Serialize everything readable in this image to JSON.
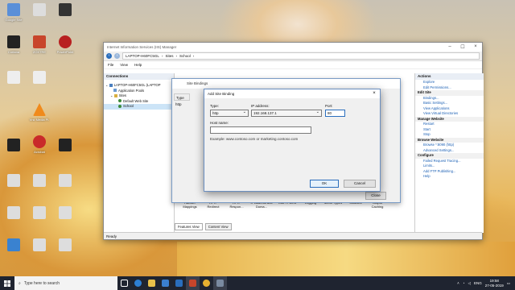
{
  "desktop": {
    "icons": [
      "Google Site",
      "",
      "",
      "Cortana",
      "ZOXTRE",
      "PowerPoint",
      "",
      "",
      "",
      "",
      "Vnc Media Pl.",
      "",
      "",
      "Acrobat",
      "",
      "",
      "",
      "",
      "",
      "",
      "",
      "",
      ""
    ]
  },
  "iis": {
    "title": "Internet Information Services (IIS) Manager",
    "breadcrumb": [
      "LAPTOP-H60FC5GL",
      "Sites",
      "School"
    ],
    "menu": [
      "File",
      "View",
      "Help"
    ],
    "connections_label": "Connections",
    "tree": [
      "LAPTOP-H60FC5GL (LAPTOP",
      "Application Pools",
      "Sites",
      "Default Web Site",
      "School"
    ],
    "features": [
      "Handler Mappings",
      "HTTP Redirect",
      "HTTP Respon...",
      "IP Address and Doma...",
      "ISAPI Filters",
      "Logging",
      "MIME Types",
      "Modules",
      "Output Caching"
    ],
    "view_tabs": [
      "Features View",
      "Content View"
    ],
    "status": "Ready",
    "actions": {
      "label": "Actions",
      "items": [
        {
          "t": "Explore",
          "h": false
        },
        {
          "t": "Edit Permissions...",
          "h": false
        },
        {
          "t": "Edit Site",
          "h": true
        },
        {
          "t": "Bindings...",
          "h": false
        },
        {
          "t": "Basic Settings...",
          "h": false
        },
        {
          "t": "View Applications",
          "h": false
        },
        {
          "t": "View Virtual Directories",
          "h": false
        },
        {
          "t": "Manage Website",
          "h": true
        },
        {
          "t": "Restart",
          "h": false
        },
        {
          "t": "Start",
          "h": false
        },
        {
          "t": "Stop",
          "h": false
        },
        {
          "t": "Browse Website",
          "h": true
        },
        {
          "t": "Browse *:8090 (http)",
          "h": false
        },
        {
          "t": "Advanced Settings...",
          "h": false
        },
        {
          "t": "Configure",
          "h": true
        },
        {
          "t": "Failed Request Tracing...",
          "h": false
        },
        {
          "t": "Limits...",
          "h": false
        },
        {
          "t": "Add FTP Publishing...",
          "h": false
        },
        {
          "t": "Help",
          "h": false
        }
      ]
    },
    "mid_labels": [
      "Filte",
      "AS",
      "Auth",
      "Con S",
      "IIS"
    ]
  },
  "site_bindings": {
    "title": "Site Bindings",
    "col_type": "Type",
    "row_type": "http",
    "close": "Close"
  },
  "add_binding": {
    "title": "Add Site Binding",
    "type_label": "Type:",
    "type_value": "http",
    "ip_label": "IP address:",
    "ip_value": "192.168.137.1",
    "port_label": "Port:",
    "port_value": "80",
    "host_label": "Host name:",
    "host_value": "",
    "example": "Example: www.contoso.com or marketing.contoso.com",
    "ok": "OK",
    "cancel": "Cancel"
  },
  "taskbar": {
    "search_placeholder": "Type here to search",
    "lang": "ENG",
    "time": "19:58",
    "date": "27-05-2019"
  }
}
